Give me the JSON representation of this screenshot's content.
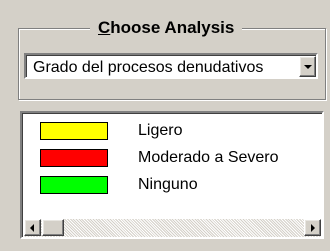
{
  "analysis": {
    "title_prefix": "C",
    "title_rest": "hoose Analysis",
    "selected": "Grado del procesos denudativos"
  },
  "legend": {
    "items": [
      {
        "label": "Ligero",
        "color": "#ffff00"
      },
      {
        "label": "Moderado a Severo",
        "color": "#ff0000"
      },
      {
        "label": "Ninguno",
        "color": "#00ff00"
      }
    ]
  },
  "icons": {
    "dropdown": "chevron-down-icon",
    "scroll_left": "arrow-left-icon",
    "scroll_right": "arrow-right-icon"
  }
}
